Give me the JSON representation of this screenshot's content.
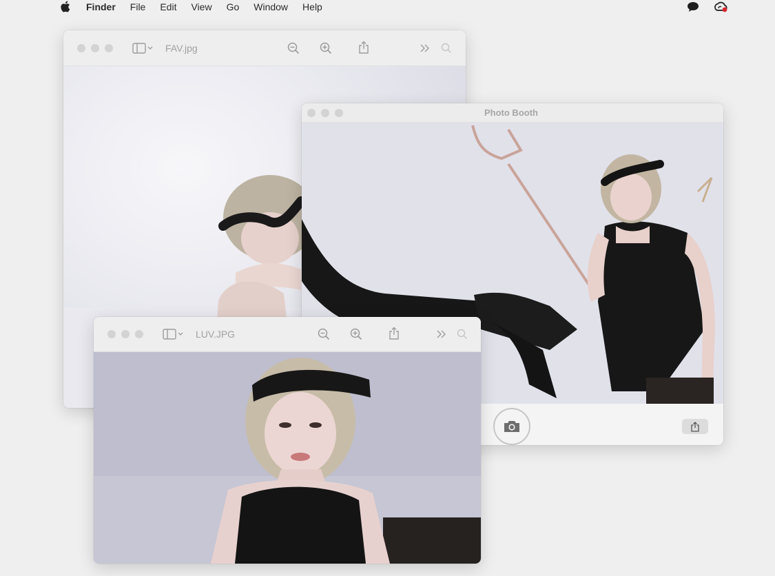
{
  "menubar": {
    "apple_icon": "apple-logo-icon",
    "app_name": "Finder",
    "items": [
      "File",
      "Edit",
      "View",
      "Go",
      "Window",
      "Help"
    ],
    "status_icons": [
      "messages-icon",
      "creative-cloud-icon"
    ]
  },
  "windows": {
    "fav": {
      "title": "FAV.jpg",
      "toolbar_icons": [
        "sidebar-toggle-icon",
        "zoom-out-icon",
        "zoom-in-icon",
        "share-icon",
        "more-icon",
        "search-icon"
      ]
    },
    "photo_booth": {
      "title": "Photo Booth",
      "bottom_icons": [
        "camera-icon",
        "share-icon"
      ]
    },
    "luv": {
      "title": "LUV.JPG",
      "toolbar_icons": [
        "sidebar-toggle-icon",
        "zoom-out-icon",
        "zoom-in-icon",
        "share-icon",
        "more-icon",
        "search-icon"
      ]
    }
  },
  "colors": {
    "traffic_light": "#d3d3d3",
    "outfit": "#141414",
    "skin": "#e9d3cf",
    "hair": "#bfb39e"
  }
}
